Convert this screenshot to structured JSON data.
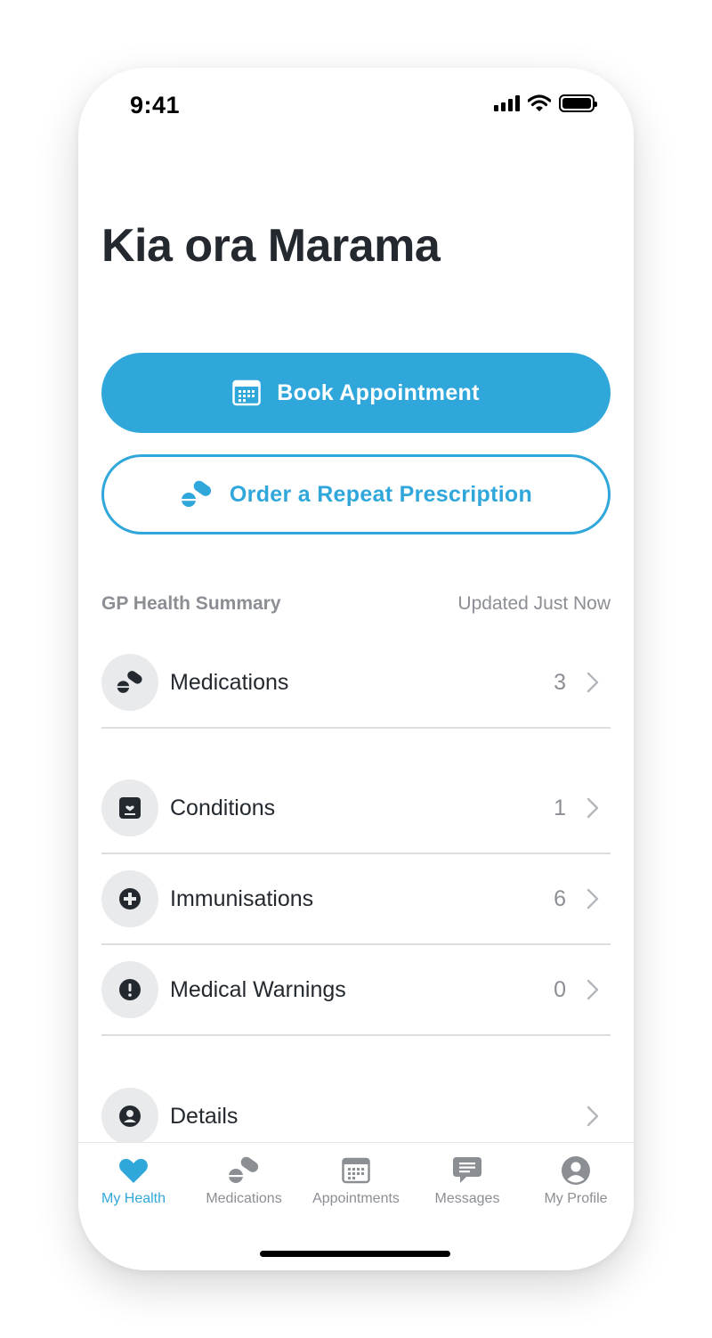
{
  "status_bar": {
    "time": "9:41"
  },
  "greeting": "Kia ora Marama",
  "actions": {
    "book_label": "Book Appointment",
    "prescription_label": "Order a Repeat Prescription"
  },
  "summary": {
    "title": "GP Health Summary",
    "updated": "Updated Just Now",
    "items": [
      {
        "label": "Medications",
        "count": "3",
        "icon": "pills-icon"
      },
      {
        "label": "Conditions",
        "count": "1",
        "icon": "condition-card-icon"
      },
      {
        "label": "Immunisations",
        "count": "6",
        "icon": "plus-circle-icon"
      },
      {
        "label": "Medical Warnings",
        "count": "0",
        "icon": "exclamation-icon"
      },
      {
        "label": "Details",
        "count": "",
        "icon": "person-icon"
      }
    ]
  },
  "tabs": [
    {
      "label": "My Health",
      "icon": "heart-icon",
      "active": true
    },
    {
      "label": "Medications",
      "icon": "pills-icon"
    },
    {
      "label": "Appointments",
      "icon": "calendar-icon"
    },
    {
      "label": "Messages",
      "icon": "message-icon"
    },
    {
      "label": "My Profile",
      "icon": "profile-icon"
    }
  ],
  "colors": {
    "accent": "#30a7db",
    "text": "#24292f",
    "muted": "#8b8f94",
    "icon_bg": "#e8eaec"
  }
}
